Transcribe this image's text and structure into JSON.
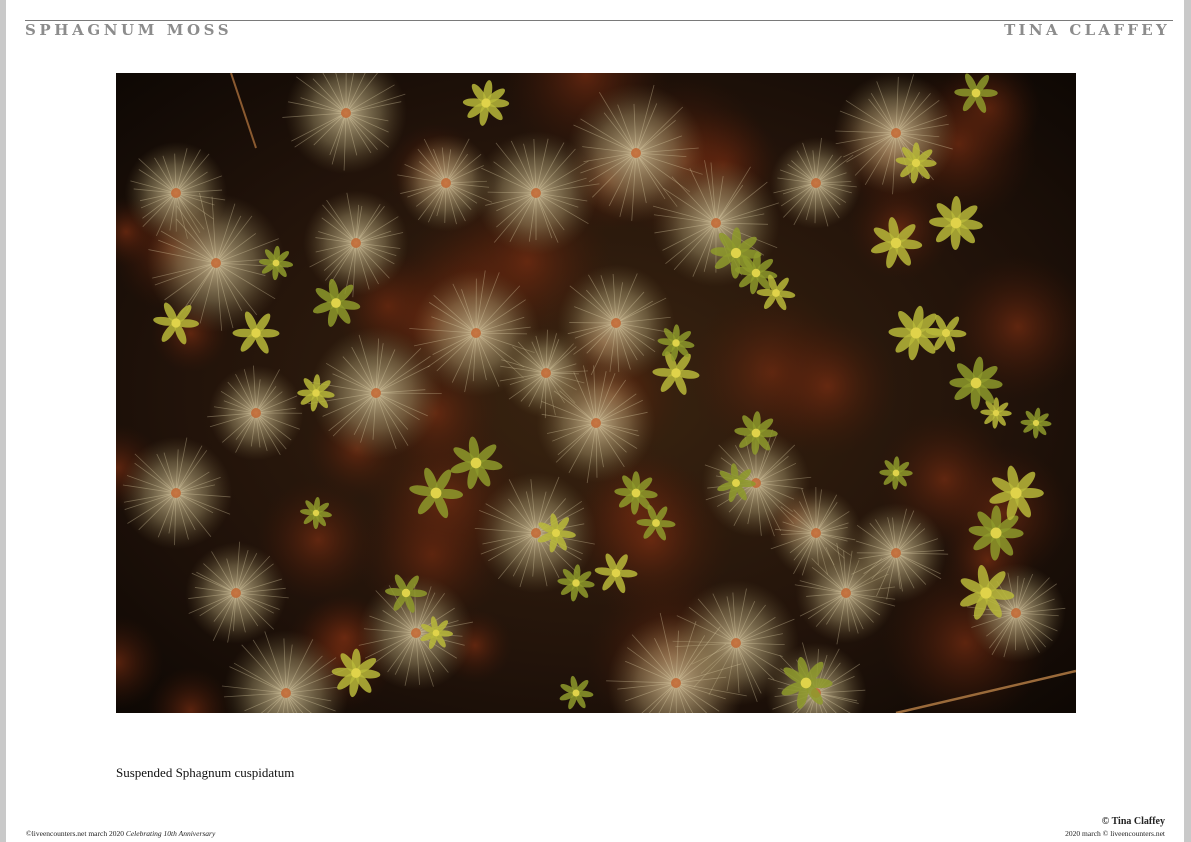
{
  "header": {
    "title": "SPHAGNUM MOSS",
    "author": "TINA CLAFFEY"
  },
  "photo": {
    "caption": "Suspended Sphagnum cuspidatum"
  },
  "footer": {
    "left_text": "©liveencounters.net march 2020",
    "left_italic": "Celebrating 10th Anniversary",
    "copyright": "© Tina Claffey",
    "right_text": "2020 march © liveencounters.net"
  },
  "colors": {
    "header_text": "#8c8c8c",
    "rule": "#7a7a7a",
    "page_bg": "#ffffff",
    "margin_bg": "#c9c9c9"
  }
}
